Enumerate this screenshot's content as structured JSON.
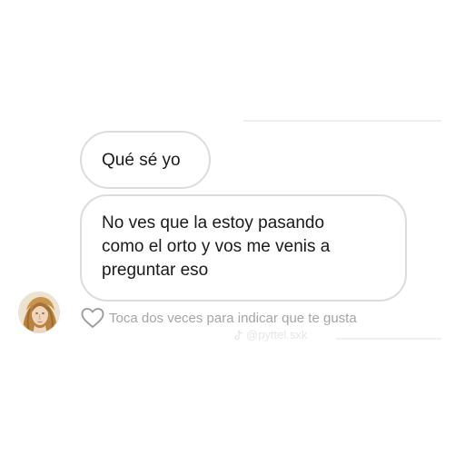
{
  "conversation": {
    "messages": [
      {
        "lines": [
          "Qué sé yo"
        ]
      },
      {
        "lines": [
          "No ves que la estoy pasando",
          "como el orto y vos me venis a",
          "preguntar eso"
        ]
      }
    ],
    "like_hint": "Toca dos veces para indicar que te gusta",
    "sender_avatar_icon": "painted-portrait-avatar",
    "like_icon": "heart-outline-icon"
  },
  "watermark": {
    "text": "@pyttel.sxk",
    "icon": "tiktok-icon"
  },
  "colors": {
    "background": "#ffffff",
    "bubble_border": "#dcdcdc",
    "text": "#1a1a1a",
    "hint_text": "#a5a5a5"
  }
}
